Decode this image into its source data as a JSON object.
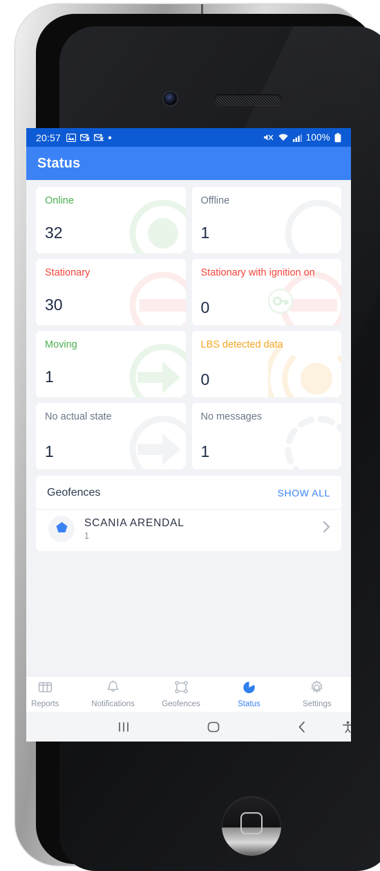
{
  "status_bar": {
    "clock": "20:57",
    "battery": "100%",
    "left_icons": [
      "image-icon",
      "email-icon",
      "email-icon",
      "dot-icon"
    ],
    "right_icons": [
      "mute-icon",
      "wifi-icon",
      "cellular-signal-icon",
      "battery-icon"
    ]
  },
  "app_bar": {
    "title": "Status"
  },
  "colors": {
    "status_bar_blue": "#0d5bd4",
    "app_bar_blue": "#3b82f6",
    "accent_blue": "#3b82f6",
    "green": "#4caf50",
    "red": "#f4453c",
    "orange": "#f5a623",
    "gray": "#6b7689",
    "value_navy": "#1c2a44",
    "page_bg": "#f1f3f6"
  },
  "cards": [
    {
      "label": "Online",
      "value": "32",
      "color": "#4caf50",
      "art": "circle-dot-icon",
      "art_color": "#eaf5ea",
      "tall": false
    },
    {
      "label": "Offline",
      "value": "1",
      "color": "#6b7689",
      "art": "circle-outline-icon",
      "art_color": "#f2f3f5",
      "tall": false
    },
    {
      "label": "Stationary",
      "value": "30",
      "color": "#f4453c",
      "art": "circle-bar-icon",
      "art_color": "#fdecec",
      "tall": false
    },
    {
      "label": "Stationary with ignition on",
      "value": "0",
      "color": "#f4453c",
      "art": "circle-bar-key-icon",
      "art_color": "#fdecec",
      "tall": true
    },
    {
      "label": "Moving",
      "value": "1",
      "color": "#4caf50",
      "art": "circle-arrow-icon",
      "art_color": "#eaf5ea",
      "tall": false
    },
    {
      "label": "LBS detected data",
      "value": "0",
      "color": "#f5a623",
      "art": "radar-signal-icon",
      "art_color": "#fdf2e0",
      "tall": true
    },
    {
      "label": "No actual state",
      "value": "1",
      "color": "#6b7689",
      "art": "circle-arrow-icon",
      "art_color": "#f2f3f5",
      "tall": true
    },
    {
      "label": "No messages",
      "value": "1",
      "color": "#6b7689",
      "art": "dashed-circle-icon",
      "art_color": "#f2f3f5",
      "tall": true
    }
  ],
  "geofences": {
    "title": "Geofences",
    "show_all_label": "SHOW ALL",
    "items": [
      {
        "name": "SCANIA ARENDAL",
        "count": "1",
        "icon": "pentagon-icon"
      }
    ],
    "chevron": "chevron-right-icon"
  },
  "tab_bar": {
    "items": [
      {
        "label": "Reports",
        "icon": "reports-icon",
        "active": false,
        "clipped": true
      },
      {
        "label": "Notifications",
        "icon": "bell-icon",
        "active": false,
        "clipped": false
      },
      {
        "label": "Geofences",
        "icon": "geofence-polygon-icon",
        "active": false,
        "clipped": false
      },
      {
        "label": "Status",
        "icon": "pie-chart-icon",
        "active": true,
        "clipped": false
      },
      {
        "label": "Settings",
        "icon": "gear-icon",
        "active": false,
        "clipped": false
      }
    ]
  },
  "system_nav": {
    "recents": "recents-icon",
    "home": "home-icon",
    "back": "back-icon",
    "accessibility": "accessibility-icon"
  }
}
